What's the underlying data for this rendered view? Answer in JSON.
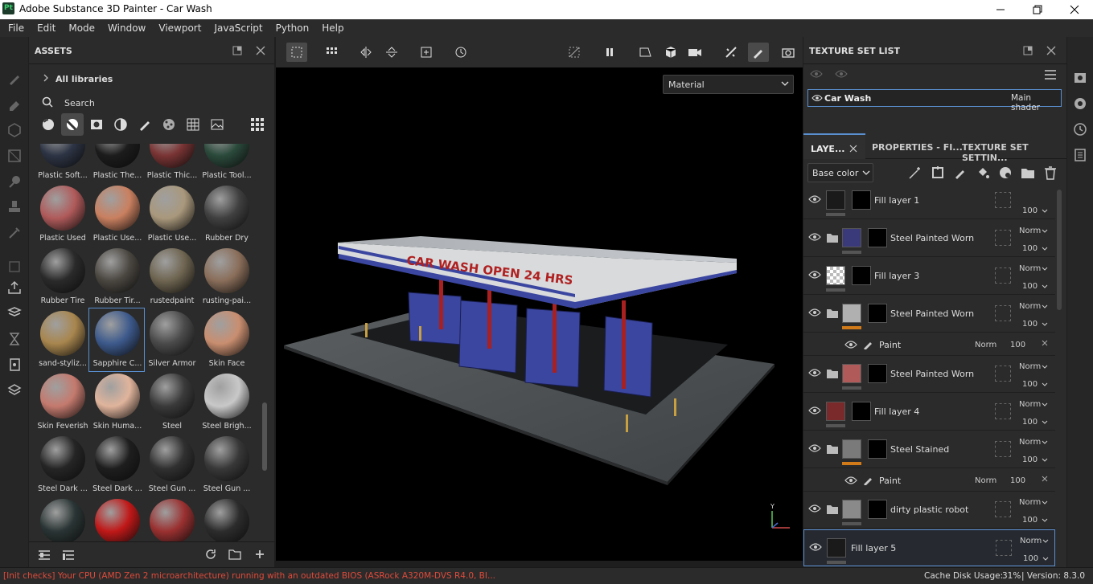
{
  "window": {
    "title": "Adobe Substance 3D Painter - Car Wash",
    "logo": "Pt"
  },
  "menu": [
    "File",
    "Edit",
    "Mode",
    "Window",
    "Viewport",
    "JavaScript",
    "Python",
    "Help"
  ],
  "assets": {
    "title": "ASSETS",
    "library": "All libraries",
    "search_placeholder": "Search",
    "materials": [
      {
        "name": "Plastic Soft...",
        "color": "#2d3444"
      },
      {
        "name": "Plastic The...",
        "color": "#1c1c1c"
      },
      {
        "name": "Plastic Thic...",
        "color": "#7a3434"
      },
      {
        "name": "Plastic Tool...",
        "color": "#2b4a3c"
      },
      {
        "name": "Plastic Used",
        "color": "#b05a5a"
      },
      {
        "name": "Plastic Use...",
        "color": "#c98060"
      },
      {
        "name": "Plastic Use...",
        "color": "#a9987c"
      },
      {
        "name": "Rubber Dry",
        "color": "#404040"
      },
      {
        "name": "Rubber Tire",
        "color": "#2a2a2a"
      },
      {
        "name": "Rubber Tir...",
        "color": "#4a4640"
      },
      {
        "name": "rustedpaint",
        "color": "#6e6450"
      },
      {
        "name": "rusting-pai...",
        "color": "#8a6e5a"
      },
      {
        "name": "sand-styliz...",
        "color": "#a8864e"
      },
      {
        "name": "Sapphire C...",
        "color": "#3d5a8c"
      },
      {
        "name": "Silver Armor",
        "color": "#4a4a4a"
      },
      {
        "name": "Skin Face",
        "color": "#c98e70"
      },
      {
        "name": "Skin Feverish",
        "color": "#c47a6e"
      },
      {
        "name": "Skin Huma...",
        "color": "#e0b49c"
      },
      {
        "name": "Steel",
        "color": "#3a3a3a"
      },
      {
        "name": "Steel Brigh...",
        "color": "#c8c8c8"
      },
      {
        "name": "Steel Dark ...",
        "color": "#252525"
      },
      {
        "name": "Steel Dark ...",
        "color": "#1e1e1e"
      },
      {
        "name": "Steel Gun ...",
        "color": "#303030"
      },
      {
        "name": "Steel Gun ...",
        "color": "#383838"
      },
      {
        "name": "",
        "color": "#2a3434"
      },
      {
        "name": "",
        "color": "#c01818"
      },
      {
        "name": "",
        "color": "#9a3030"
      },
      {
        "name": "",
        "color": "#2c2c2c"
      }
    ],
    "selected_index": 13
  },
  "viewport": {
    "mode_select": "Material",
    "sign_text": "CAR WASH OPEN 24 HRS",
    "axis_y": "Y"
  },
  "texture_set_list": {
    "title": "TEXTURE SET LIST",
    "set_name": "Car Wash",
    "shader": "Main shader"
  },
  "layers_panel": {
    "tabs": [
      "LAYE...",
      "PROPERTIES - FI...",
      "TEXTURE SET SETTIN..."
    ],
    "channel": "Base color",
    "layers": [
      {
        "name": "Fill layer 1",
        "blend": "",
        "opacity": "100",
        "folder": false,
        "thumb": "#1a1a1a",
        "mask": "#000",
        "bar": "#555"
      },
      {
        "name": "Steel Painted Worn",
        "blend": "Norm",
        "opacity": "100",
        "folder": true,
        "thumb": "#3a3a7a",
        "mask": "#000",
        "bar": "#555"
      },
      {
        "name": "Fill layer 3",
        "blend": "Norm",
        "opacity": "100",
        "folder": false,
        "thumb": "checker",
        "mask": "#000",
        "bar": "#555"
      },
      {
        "name": "Steel Painted Worn",
        "blend": "Norm",
        "opacity": "100",
        "folder": true,
        "thumb": "#b0b0b0",
        "mask": "#000",
        "bar": "#d07a1a"
      },
      {
        "name": "Paint",
        "blend": "Norm",
        "opacity": "100",
        "sub": true
      },
      {
        "name": "Steel Painted Worn",
        "blend": "Norm",
        "opacity": "100",
        "folder": true,
        "thumb": "#b05a5a",
        "mask": "#000",
        "bar": "#555"
      },
      {
        "name": "Fill layer 4",
        "blend": "Norm",
        "opacity": "100",
        "folder": false,
        "thumb": "#7a2a2a",
        "mask": "#000",
        "bar": "#555"
      },
      {
        "name": "Steel Stained",
        "blend": "Norm",
        "opacity": "100",
        "folder": true,
        "thumb": "#7a7a7a",
        "mask": "#000",
        "bar": "#d07a1a"
      },
      {
        "name": "Paint",
        "blend": "Norm",
        "opacity": "100",
        "sub": true
      },
      {
        "name": "dirty plastic robot",
        "blend": "Norm",
        "opacity": "100",
        "folder": true,
        "thumb": "#8a8a8a",
        "mask": "#000",
        "bar": "#555"
      },
      {
        "name": "Fill layer 5",
        "blend": "Norm",
        "opacity": "100",
        "folder": false,
        "thumb": "#1a1a1a",
        "mask": "",
        "bar": "#555",
        "selected": true
      }
    ]
  },
  "status": {
    "warning": "[Init checks] Your CPU (AMD Zen 2 microarchitecture) running with an outdated BIOS (ASRock A320M-DVS R4.0, BI...",
    "cache": "Cache Disk Usage:",
    "cache_value": "31%",
    "version": "| Version: 8.3.0"
  },
  "colors": {
    "accent": "#5a8fd0",
    "warning": "#e04a3a",
    "orange": "#d07a1a"
  }
}
